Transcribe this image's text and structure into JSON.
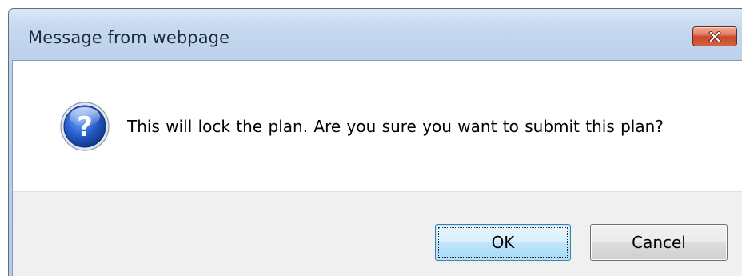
{
  "dialog": {
    "title": "Message from webpage",
    "message": "This will lock the plan.  Are you sure you want to submit this plan?",
    "icon": "question-icon",
    "close_icon": "close-icon",
    "ok_label": "OK",
    "cancel_label": "Cancel"
  },
  "colors": {
    "title_bar": "#c7d9ef",
    "close_button": "#c84a2c",
    "question_icon": "#1f4fb0",
    "default_button_border": "#3c7fb1",
    "button_area": "#f0f0f0"
  }
}
